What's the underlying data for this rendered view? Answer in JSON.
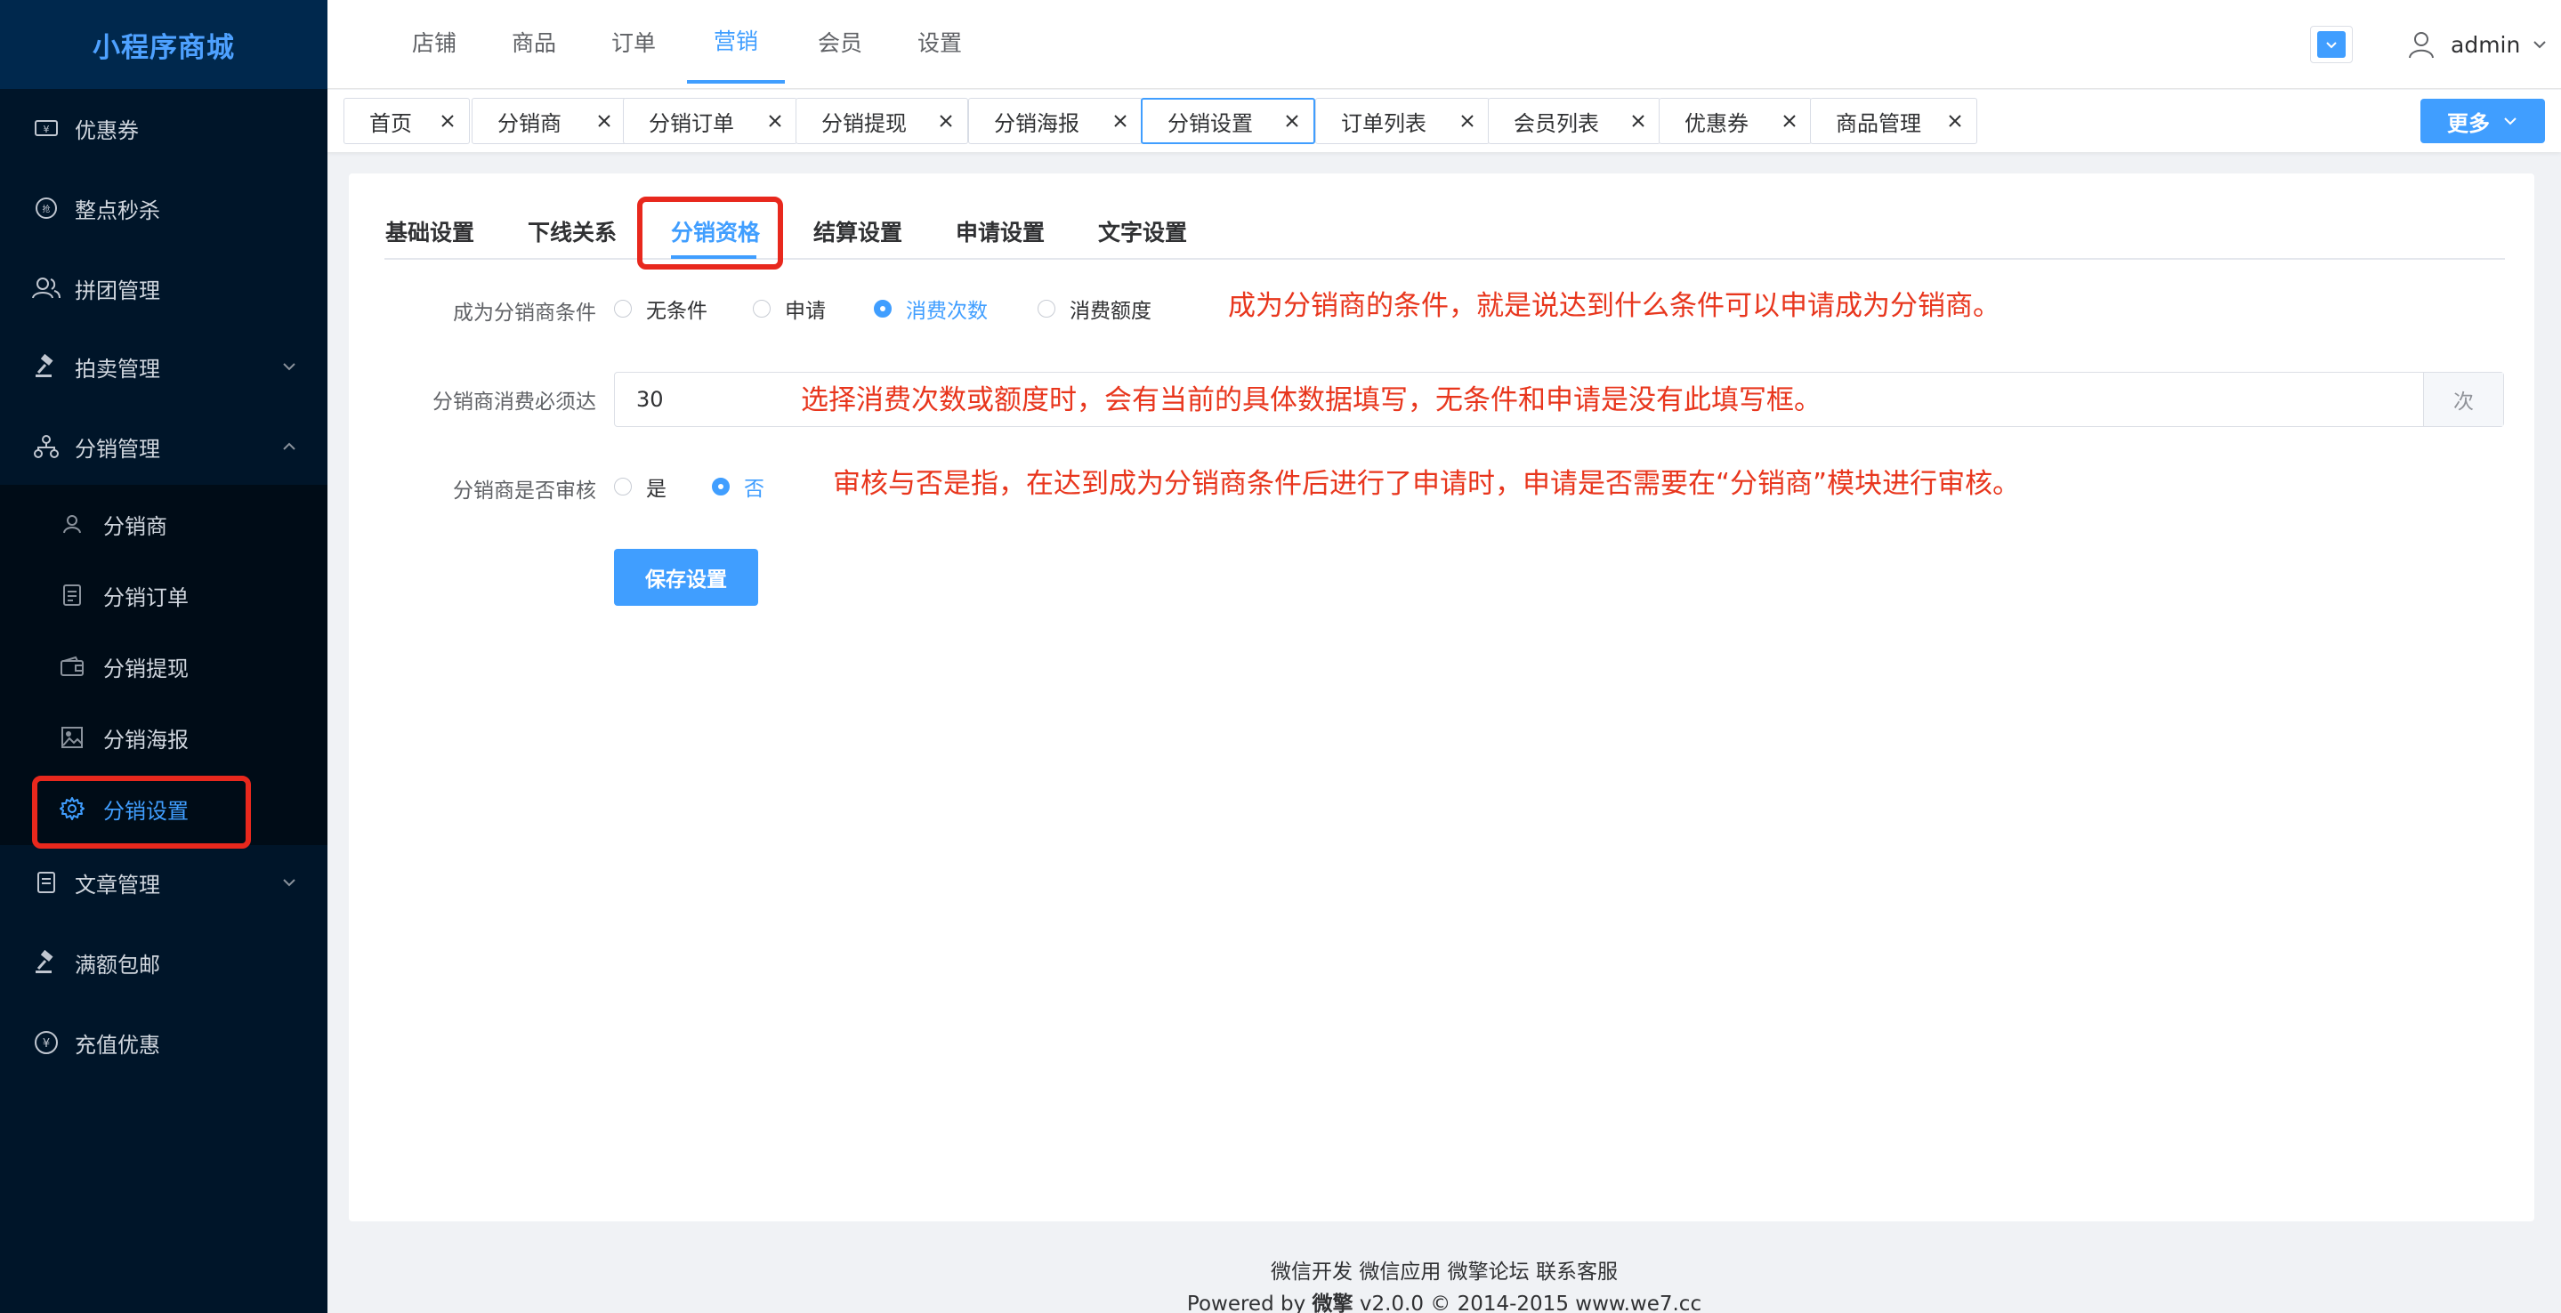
{
  "brand": "小程序商城",
  "sidebar": {
    "items": [
      {
        "label": "优惠券",
        "icon": "coupon-icon"
      },
      {
        "label": "整点秒杀",
        "icon": "flash-sale-icon"
      },
      {
        "label": "拼团管理",
        "icon": "group-buy-icon"
      },
      {
        "label": "拍卖管理",
        "icon": "auction-icon"
      },
      {
        "label": "分销管理",
        "icon": "distribution-icon"
      },
      {
        "label": "文章管理",
        "icon": "article-icon"
      },
      {
        "label": "满额包邮",
        "icon": "free-shipping-icon"
      },
      {
        "label": "充值优惠",
        "icon": "recharge-icon"
      }
    ],
    "sub_items": [
      {
        "label": "分销商",
        "icon": "user-icon"
      },
      {
        "label": "分销订单",
        "icon": "document-icon"
      },
      {
        "label": "分销提现",
        "icon": "wallet-icon"
      },
      {
        "label": "分销海报",
        "icon": "picture-icon"
      },
      {
        "label": "分销设置",
        "icon": "gear-icon",
        "active": true
      }
    ]
  },
  "header": {
    "nav": [
      "店铺",
      "商品",
      "订单",
      "营销",
      "会员",
      "设置"
    ],
    "active_nav": "营销",
    "username": "admin"
  },
  "tags": [
    {
      "label": "首页"
    },
    {
      "label": "分销商"
    },
    {
      "label": "分销订单"
    },
    {
      "label": "分销提现"
    },
    {
      "label": "分销海报"
    },
    {
      "label": "分销设置",
      "active": true
    },
    {
      "label": "订单列表"
    },
    {
      "label": "会员列表"
    },
    {
      "label": "优惠券"
    },
    {
      "label": "商品管理"
    }
  ],
  "more_label": "更多",
  "sub_tabs": [
    "基础设置",
    "下线关系",
    "分销资格",
    "结算设置",
    "申请设置",
    "文字设置"
  ],
  "active_sub_tab": "分销资格",
  "form": {
    "condition": {
      "label": "成为分销商条件",
      "options": [
        "无条件",
        "申请",
        "消费次数",
        "消费额度"
      ],
      "selected": "消费次数"
    },
    "min_consume": {
      "label": "分销商消费必须达",
      "value": "30",
      "suffix": "次"
    },
    "review": {
      "label": "分销商是否审核",
      "options": [
        "是",
        "否"
      ],
      "selected": "否"
    },
    "save_label": "保存设置"
  },
  "annotations": {
    "note1": "成为分销商的条件，就是说达到什么条件可以申请成为分销商。",
    "note2": "选择消费次数或额度时，会有当前的具体数据填写，无条件和申请是没有此填写框。",
    "note3": "审核与否是指，在达到成为分销商条件后进行了申请时，申请是否需要在“分销商”模块进行审核。"
  },
  "footer": {
    "links": "微信开发 微信应用 微擎论坛 联系客服",
    "powered_prefix": "Powered by ",
    "powered_brand": "微擎",
    "powered_suffix": " v2.0.0 © 2014-2015 www.we7.cc"
  },
  "colors": {
    "sidebar_bg": "#001529",
    "accent": "#409eff",
    "annotation_red": "#e8361d"
  }
}
